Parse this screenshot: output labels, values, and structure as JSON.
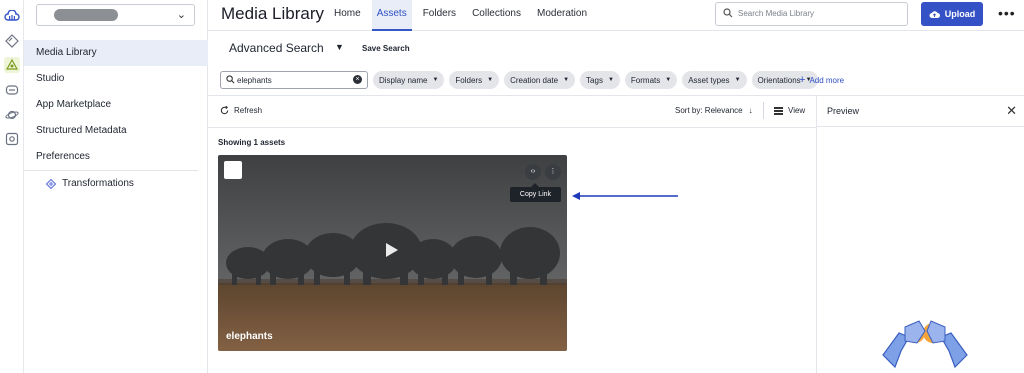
{
  "sidebar": {
    "items": [
      {
        "label": "Media Library"
      },
      {
        "label": "Studio"
      },
      {
        "label": "App Marketplace"
      },
      {
        "label": "Structured Metadata"
      },
      {
        "label": "Preferences"
      },
      {
        "label": "Transformations"
      }
    ]
  },
  "header": {
    "title": "Media Library",
    "tabs": [
      {
        "label": "Home"
      },
      {
        "label": "Assets"
      },
      {
        "label": "Folders"
      },
      {
        "label": "Collections"
      },
      {
        "label": "Moderation"
      }
    ],
    "search_placeholder": "Search Media Library",
    "upload_label": "Upload",
    "more_label": "•••"
  },
  "advanced": {
    "title": "Advanced Search",
    "save_label": "Save Search"
  },
  "filters": {
    "query": "elephants",
    "chips": [
      {
        "label": "Display name"
      },
      {
        "label": "Folders"
      },
      {
        "label": "Creation date"
      },
      {
        "label": "Tags"
      },
      {
        "label": "Formats"
      },
      {
        "label": "Asset types"
      },
      {
        "label": "Orientations"
      }
    ],
    "add_more_label": "Add more"
  },
  "toolbar": {
    "refresh_label": "Refresh",
    "sort_label": "Sort by: Relevance",
    "view_label": "View"
  },
  "results": {
    "count_label": "Showing 1 assets",
    "asset_name": "elephants",
    "tooltip": "Copy Link"
  },
  "preview": {
    "title": "Preview"
  },
  "colors": {
    "accent": "#3452c5",
    "active_bg": "#e9edf8",
    "arrow": "#1f3ab8"
  }
}
